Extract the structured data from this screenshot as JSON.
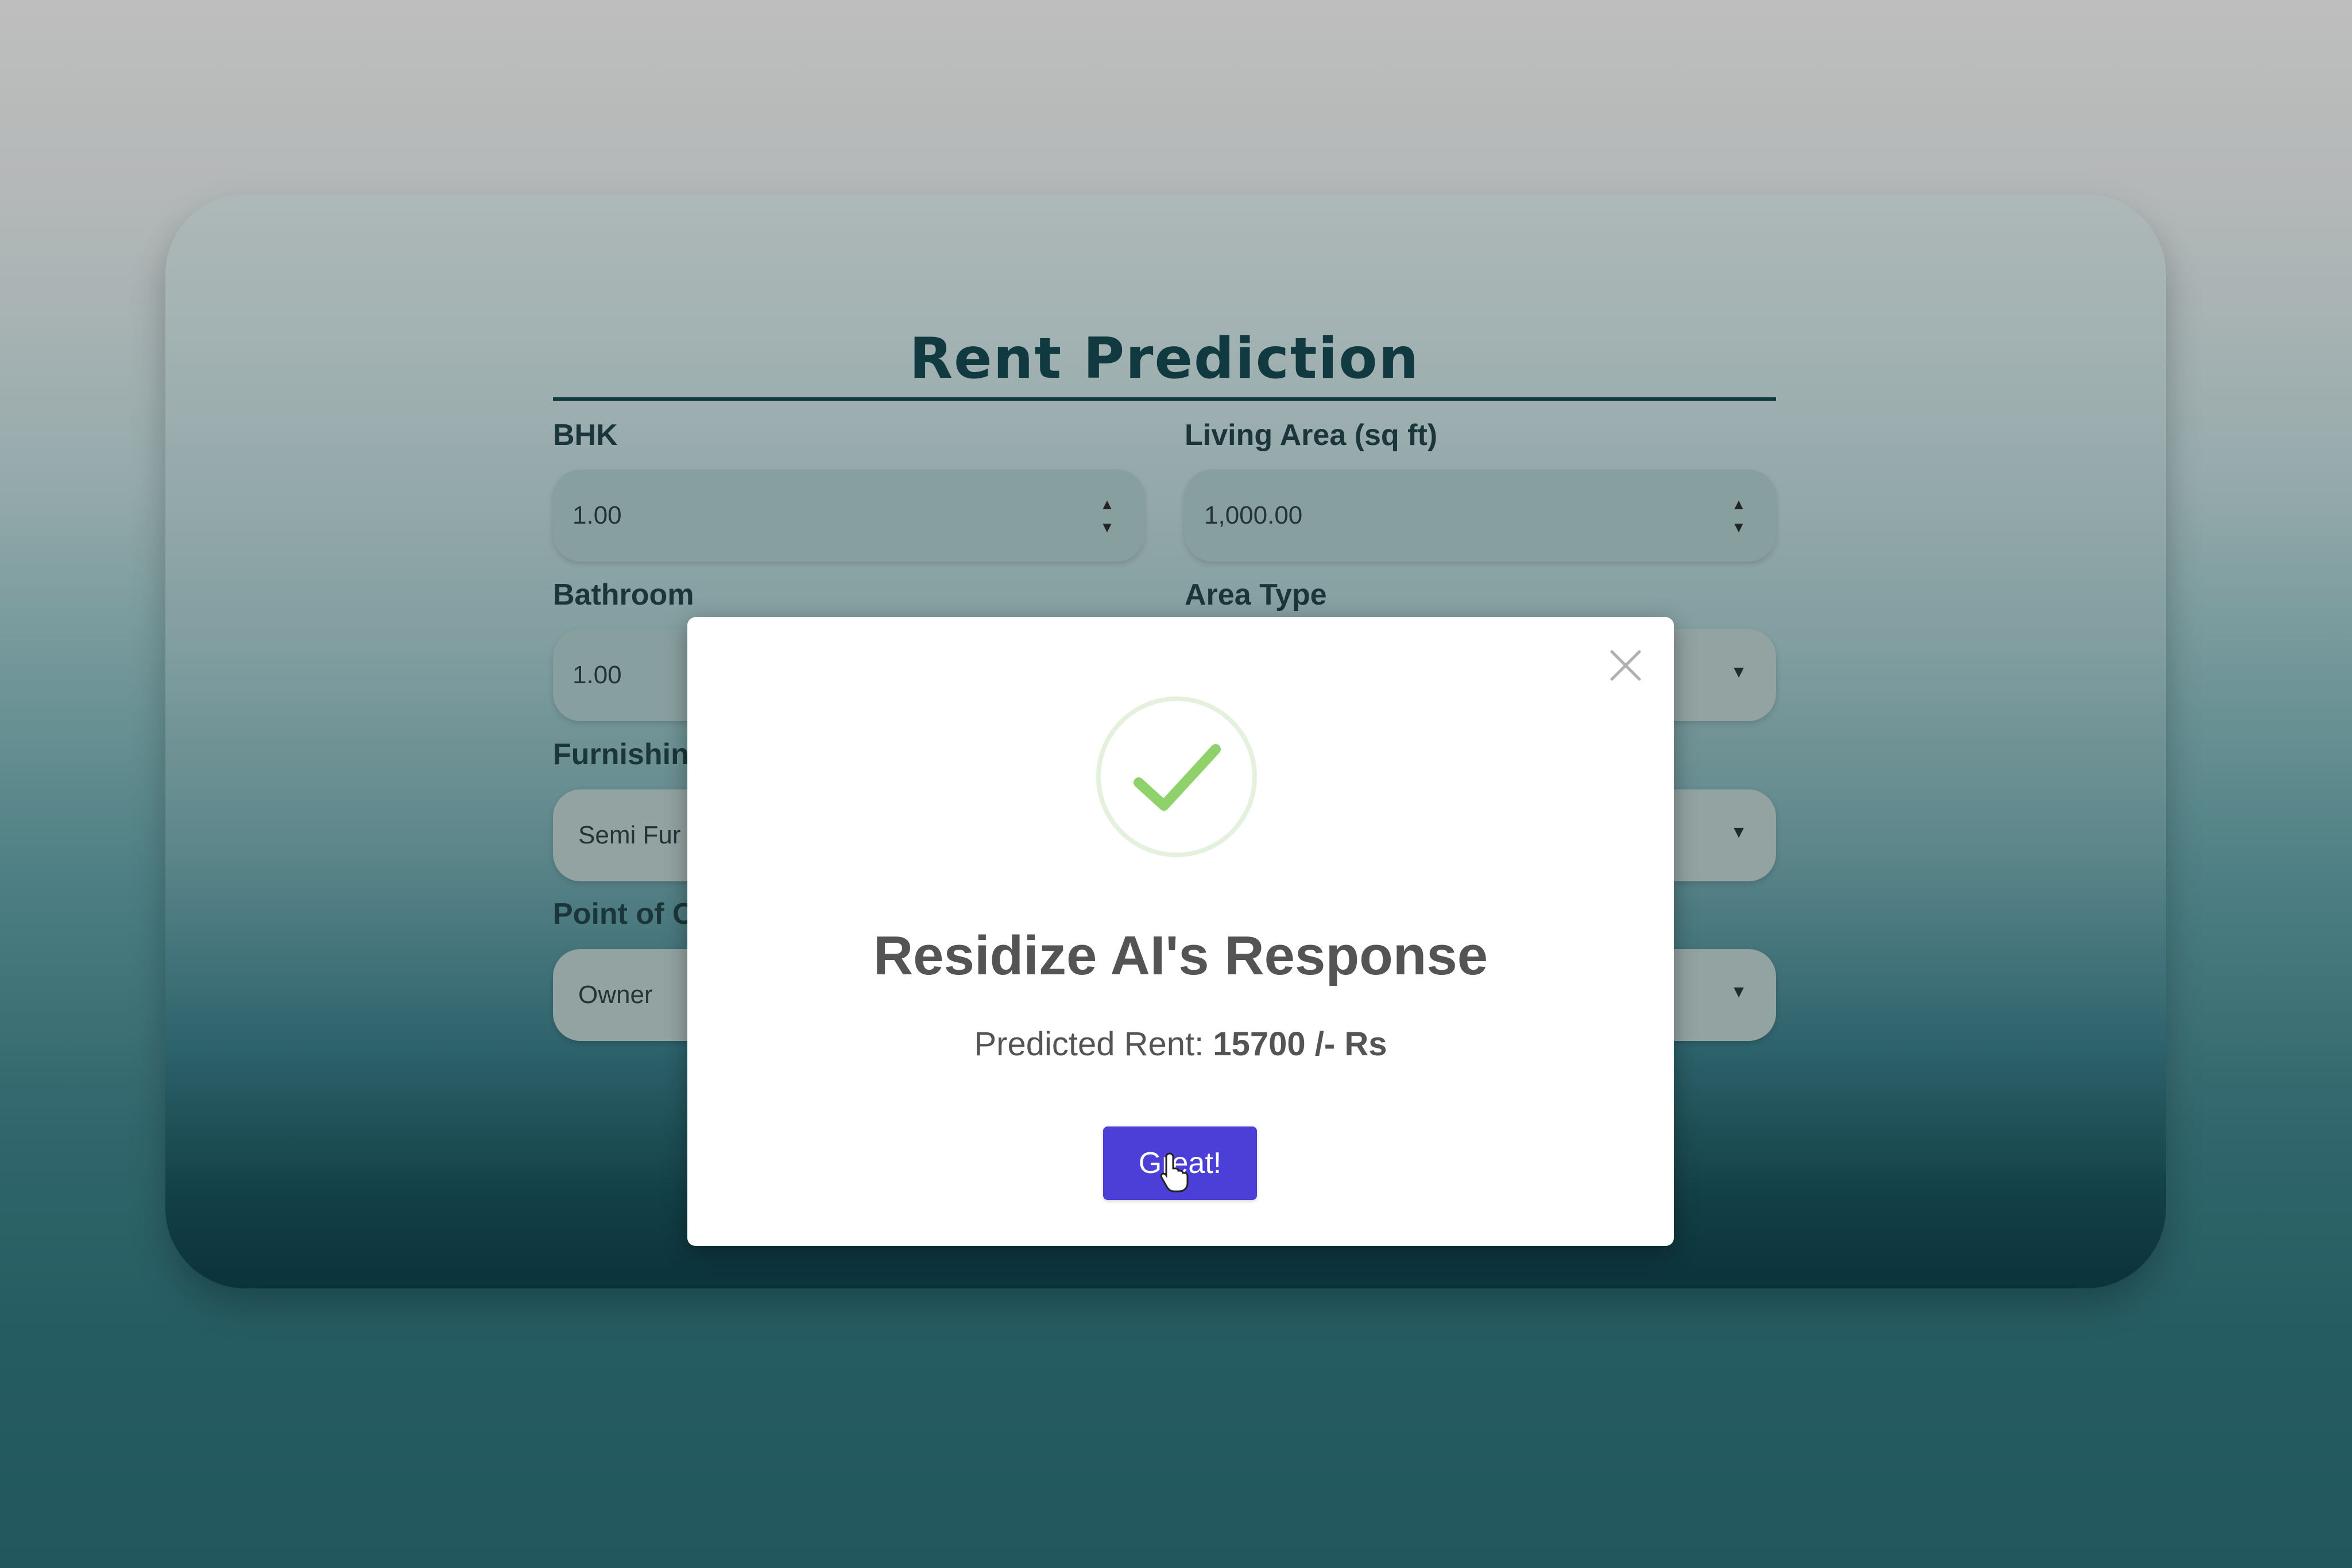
{
  "page": {
    "title": "Rent Prediction"
  },
  "form": {
    "bhk": {
      "label": "BHK",
      "value": "1.00"
    },
    "living_area": {
      "label": "Living Area (sq ft)",
      "value": "1,000.00"
    },
    "bathroom": {
      "label": "Bathroom",
      "value": "1.00"
    },
    "area_type": {
      "label": "Area Type"
    },
    "furnishing": {
      "label": "Furnishin",
      "value": "Semi Fur"
    },
    "point_of_contact": {
      "label": "Point of C",
      "value": "Owner"
    }
  },
  "modal": {
    "title": "Residize AI's Response",
    "result_label": "Predicted Rent:",
    "result_value": "15700 /- Rs",
    "confirm_label": "Great!",
    "icons": [
      "close-icon",
      "success-checkmark-icon",
      "hand-pointer-cursor"
    ]
  },
  "colors": {
    "title": "#0c3a3f",
    "confirm_button": "#4c3fd8",
    "checkmark": "#8fd16a",
    "modal_text": "#545454"
  }
}
